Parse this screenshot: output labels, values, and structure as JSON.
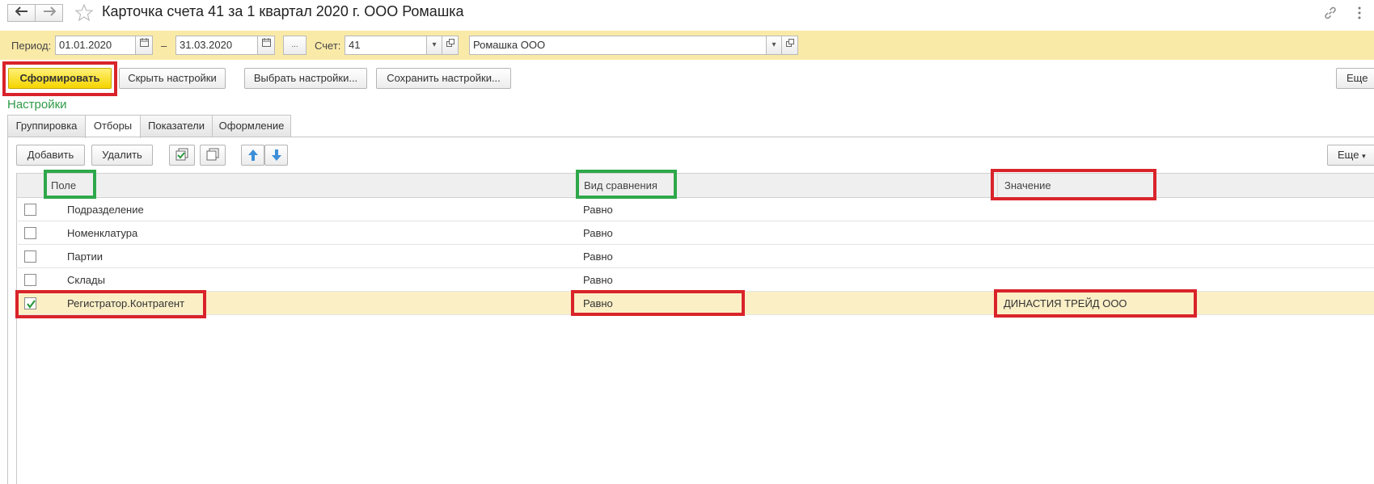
{
  "window": {
    "title": "Карточка счета 41 за 1 квартал 2020 г. ООО Ромашка",
    "back_icon": "arrow-left-icon",
    "forward_icon": "arrow-right-icon",
    "favorite_icon": "star-icon",
    "link_icon": "link-icon",
    "more_icon": "vertical-dots-icon"
  },
  "period_bar": {
    "period_label": "Период:",
    "date_from": "01.01.2020",
    "dash": "–",
    "date_to": "31.03.2020",
    "ellipsis_label": "...",
    "account_label": "Счет:",
    "account_value": "41",
    "organization_value": "Ромашка ООО"
  },
  "toolbar": {
    "generate_label": "Сформировать",
    "hide_settings_label": "Скрыть настройки",
    "choose_settings_label": "Выбрать настройки...",
    "save_settings_label": "Сохранить настройки...",
    "more_label": "Еще"
  },
  "settings": {
    "title": "Настройки",
    "tabs": [
      {
        "label": "Группировка",
        "active": false
      },
      {
        "label": "Отборы",
        "active": true
      },
      {
        "label": "Показатели",
        "active": false
      },
      {
        "label": "Оформление",
        "active": false
      }
    ],
    "filters_toolbar": {
      "add_label": "Добавить",
      "delete_label": "Удалить",
      "more_label": "Еще"
    }
  },
  "filters_table": {
    "columns": [
      "Поле",
      "Вид сравнения",
      "Значение"
    ],
    "rows": [
      {
        "checked": false,
        "field": "Подразделение",
        "comparison": "Равно",
        "value": ""
      },
      {
        "checked": false,
        "field": "Номенклатура",
        "comparison": "Равно",
        "value": ""
      },
      {
        "checked": false,
        "field": "Партии",
        "comparison": "Равно",
        "value": ""
      },
      {
        "checked": false,
        "field": "Склады",
        "comparison": "Равно",
        "value": ""
      },
      {
        "checked": true,
        "field": "Регистратор.Контрагент",
        "comparison": "Равно",
        "value": "ДИНАСТИЯ ТРЕЙД ООО"
      }
    ]
  },
  "colors": {
    "accent_yellow": "#f5d400",
    "band_yellow": "#faeaa8",
    "selected_row": "#fbefc6",
    "highlight_red": "#d9232a",
    "highlight_green": "#2ea84a",
    "settings_green": "#2e9a45"
  }
}
